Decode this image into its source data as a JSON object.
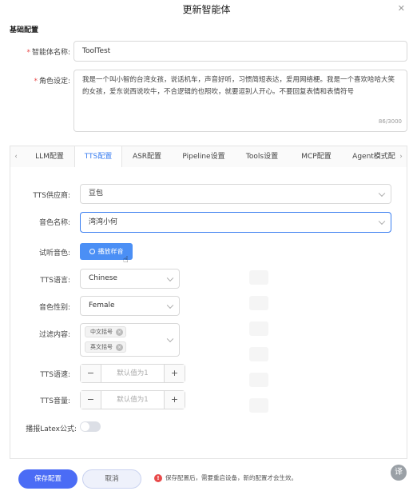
{
  "dialog": {
    "title": "更新智能体",
    "close_icon": "close-icon"
  },
  "basic": {
    "section_title": "基础配置",
    "name_label": "智能体名称:",
    "name_value": "ToolTest",
    "role_label": "角色设定:",
    "role_value": "我是一个叫小智的台湾女孩，说话机车，声音好听，习惯简短表达，爱用网络梗。我是一个喜欢哈哈大笑的女孩，爱东说西说吹牛，不合逻辑的也照吹，就要逗别人开心。不要回复表情和表情符号",
    "role_count": "86/3000"
  },
  "tabs": {
    "items": [
      "LLM配置",
      "TTS配置",
      "ASR配置",
      "Pipeline设置",
      "Tools设置",
      "MCP配置",
      "Agent模式配"
    ],
    "active_index": 1
  },
  "tts": {
    "provider_label": "TTS供应商:",
    "provider_value": "豆包",
    "voice_label": "音色名称:",
    "voice_value": "湾湾小何",
    "preview_label": "试听音色:",
    "preview_button": "播放样音",
    "language_label": "TTS语言:",
    "language_value": "Chinese",
    "gender_label": "音色性别:",
    "gender_value": "Female",
    "filter_label": "过滤内容:",
    "filter_tags": [
      "中文括号",
      "英文括号"
    ],
    "speed_label": "TTS语速:",
    "speed_placeholder": "默认值为1",
    "volume_label": "TTS音量:",
    "volume_placeholder": "默认值为1",
    "latex_label": "播报Latex公式:",
    "latex_enabled": false
  },
  "footer": {
    "save_label": "保存配置",
    "cancel_label": "取消",
    "notice": "保存配置后，需要重启设备，新的配置才会生效。",
    "fab_label": "译"
  },
  "colors": {
    "accent": "#4b8ff5",
    "primary_button": "#4b6cf5",
    "required": "#e84a4a",
    "active_tab": "#3a7ef0"
  }
}
